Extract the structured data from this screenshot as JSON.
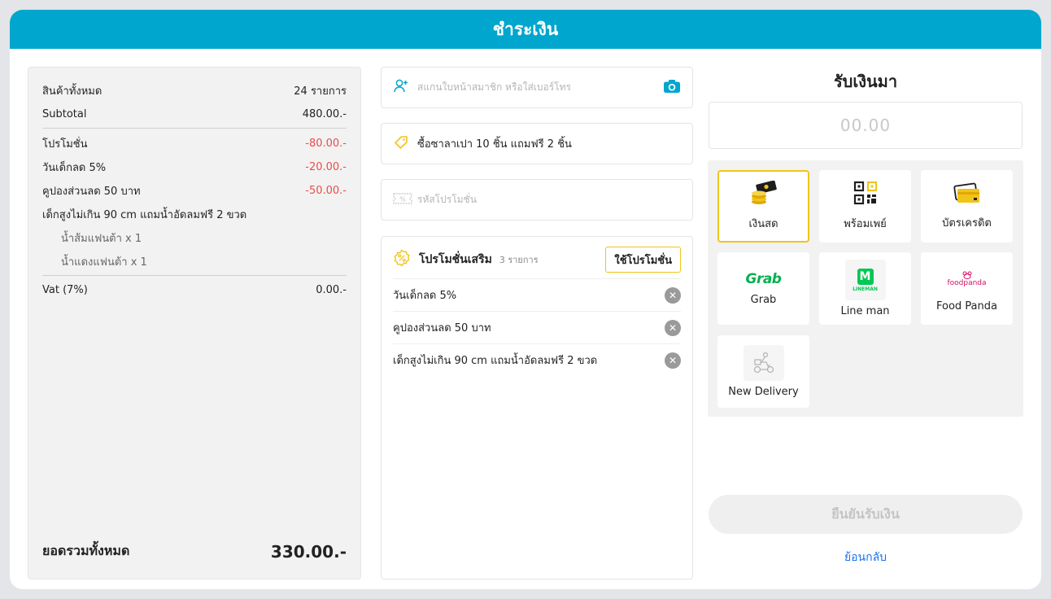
{
  "header": {
    "title": "ชำระเงิน"
  },
  "summary": {
    "rows": [
      {
        "label": "สินค้าทั้งหมด",
        "value": "24 รายการ"
      },
      {
        "label": "Subtotal",
        "value": "480.00.-"
      },
      {
        "label": "โปรโมชั่น",
        "value": "-80.00.-"
      },
      {
        "label": "วันเด็กลด 5%",
        "value": "-20.00.-"
      },
      {
        "label": "คูปองส่วนลด 50 บาท",
        "value": "-50.00.-"
      },
      {
        "label": "เด็กสูงไม่เกิน 90 cm แถมน้ำอัดลมฟรี 2 ขวด",
        "value": ""
      },
      {
        "label": "น้ำส้มแฟนต้า x 1",
        "value": ""
      },
      {
        "label": "น้ำแดงแฟนต้า x 1",
        "value": ""
      },
      {
        "label": "Vat (7%)",
        "value": "0.00.-"
      }
    ],
    "total_label": "ยอดรวมทั้งหมด",
    "total_value": "330.00.-"
  },
  "member": {
    "placeholder": "สแกนใบหน้าสมาชิก หรือใส่เบอร์โทร"
  },
  "promo_banner": {
    "text": "ซื้อซาลาเปา 10 ชิ้น แถมฟรี 2 ชิ้น"
  },
  "promo_code": {
    "placeholder": "รหัสโปรโมชั่น"
  },
  "extra_promos": {
    "title": "โปรโมชั่นเสริม",
    "count": "3 รายการ",
    "apply_label": "ใช้โปรโมชั่น",
    "items": [
      {
        "label": "วันเด็กลด 5%"
      },
      {
        "label": "คูปองส่วนลด 50 บาท"
      },
      {
        "label": "เด็กสูงไม่เกิน 90 cm แถมน้ำอัดลมฟรี 2 ขวด"
      }
    ]
  },
  "payment": {
    "title": "รับเงินมา",
    "amount_placeholder": "00.00",
    "methods": [
      {
        "label": "เงินสด",
        "icon": "cash-icon",
        "selected": true
      },
      {
        "label": "พร้อมเพย์",
        "icon": "qr-code-icon"
      },
      {
        "label": "บัตรเครดิต",
        "icon": "credit-card-icon"
      },
      {
        "label": "Grab",
        "icon": "grab-logo",
        "logo_text": "Grab"
      },
      {
        "label": "Line man",
        "icon": "lineman-logo",
        "logo_text": "LINEMAN"
      },
      {
        "label": "Food Panda",
        "icon": "foodpanda-logo",
        "logo_text": "foodpanda"
      },
      {
        "label": "New Delivery",
        "icon": "delivery-rider-icon"
      }
    ],
    "confirm_label": "ยืนยันรับเงิน",
    "back_label": "ย้อนกลับ"
  },
  "colors": {
    "header": "#00a6cd",
    "accent_yellow": "#f0c419",
    "discount_red": "#ec4b4b",
    "link_blue": "#1a73e8",
    "grab_green": "#00b14f",
    "lineman_green": "#06c755",
    "foodpanda_pink": "#d70f64"
  }
}
